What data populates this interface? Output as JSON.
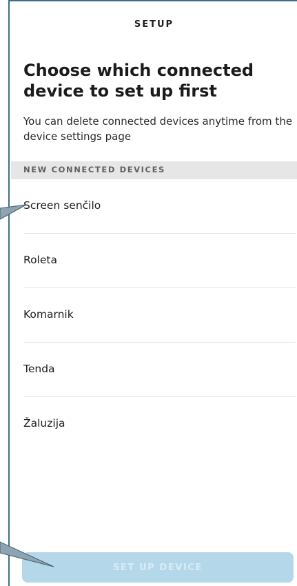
{
  "header": {
    "title": "SETUP"
  },
  "main": {
    "title": "Choose which connected device to set up first",
    "subtitle": "You can delete connected devices anytime from the device settings page",
    "section_label": "NEW CONNECTED DEVICES",
    "devices": [
      {
        "label": "Screen senčilo"
      },
      {
        "label": "Roleta"
      },
      {
        "label": "Komarnik"
      },
      {
        "label": "Tenda"
      },
      {
        "label": "Žaluzija"
      }
    ]
  },
  "footer": {
    "setup_button_label": "SET UP DEVICE",
    "setup_button_state": "disabled"
  },
  "colors": {
    "button_disabled_bg": "#b4d8ea",
    "callout_fill": "#8fa3b1",
    "frame_border": "#3f6f86"
  }
}
